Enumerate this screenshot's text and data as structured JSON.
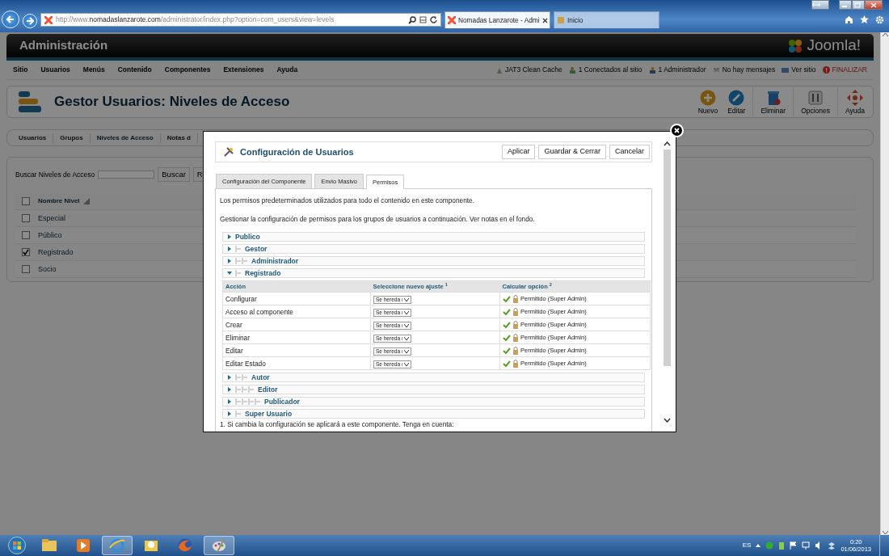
{
  "browser": {
    "url": "http://www.**nomadaslanzarote.com**/administrator/index.php?option=com_users&view=levels",
    "tabs": [
      {
        "title": "Nomadas Lanzarote - Admi",
        "selected": true,
        "closable": true
      },
      {
        "title": "Inicio",
        "selected": false,
        "closable": false
      }
    ]
  },
  "admin": {
    "title": "Administración",
    "logo": "Joomla!",
    "menu": [
      "Sitio",
      "Usuarios",
      "Menús",
      "Contenido",
      "Componentes",
      "Extensiones",
      "Ayuda"
    ],
    "status": [
      {
        "label": "JAT3 Clean Cache",
        "kind": "cache"
      },
      {
        "label": "1 Conectados al sitio",
        "kind": "users"
      },
      {
        "label": "1 Administrador",
        "kind": "admin"
      },
      {
        "label": "No hay mensajes",
        "kind": "mail"
      },
      {
        "label": "Ver sitio",
        "kind": "site"
      },
      {
        "label": "FINALIZAR",
        "kind": "logout"
      }
    ],
    "page_title": "Gestor Usuarios: Niveles de Acceso",
    "toolbar": [
      {
        "label": "Nuevo",
        "kind": "new"
      },
      {
        "label": "Editar",
        "kind": "edit"
      },
      {
        "label": "Eliminar",
        "kind": "delete"
      },
      {
        "label": "Opciones",
        "kind": "options"
      },
      {
        "label": "Ayuda",
        "kind": "help"
      }
    ],
    "subtabs": [
      {
        "label": "Usuarios",
        "selected": false
      },
      {
        "label": "Grupos",
        "selected": false
      },
      {
        "label": "Niveles de Acceso",
        "selected": true
      },
      {
        "label": "Notas d",
        "selected": false
      }
    ],
    "search": {
      "label": "Buscar Niveles de Acceso",
      "button": "Buscar",
      "reset": "R"
    },
    "levels": {
      "column": "Nombre Nivel",
      "all_checked": false,
      "rows": [
        {
          "name": "Especial",
          "checked": false
        },
        {
          "name": "Público",
          "checked": false
        },
        {
          "name": "Registrado",
          "checked": true
        },
        {
          "name": "Socio",
          "checked": false
        }
      ]
    }
  },
  "modal": {
    "title": "Configuración de Usuarios",
    "buttons": [
      "Aplicar",
      "Guardar & Cerrar",
      "Cancelar"
    ],
    "tabs": [
      {
        "label": "Configuración del Componente",
        "selected": false
      },
      {
        "label": "Envio Masivo",
        "selected": false
      },
      {
        "label": "Permisos",
        "selected": true
      }
    ],
    "intro": [
      "Los permisos predeterminados utilizados para todo el contenido en este componente.",
      "Gestionar la configuración de permisos para los grupos de usuarios a continuación. Ver notas en el fondo."
    ],
    "columns": [
      "Acción",
      "Seleccione nuevo ajuste $^{1}$",
      "Calcular opción $^{2}$"
    ],
    "groups": [
      {
        "label": "Publico",
        "expanded": false,
        "children": [
          {
            "label": "Gestor",
            "expanded": false,
            "children": [
              {
                "label": "Administrador",
                "expanded": false
              }
            ]
          },
          {
            "label": "Registrado",
            "expanded": true,
            "permissions": [
              {
                "action": "Configurar",
                "setting": "Se hereda",
                "result": "Permitido (Super Admin)"
              },
              {
                "action": "Acceso al componente",
                "setting": "Se hereda",
                "result": "Permitido (Super Admin)"
              },
              {
                "action": "Crear",
                "setting": "Se hereda",
                "result": "Permitido (Super Admin)"
              },
              {
                "action": "Eliminar",
                "setting": "Se hereda",
                "result": "Permitido (Super Admin)"
              },
              {
                "action": "Editar",
                "setting": "Se hereda",
                "result": "Permitido (Super Admin)"
              },
              {
                "action": "Editar Estado",
                "setting": "Se hereda",
                "result": "Permitido (Super Admin)"
              }
            ],
            "children": [
              {
                "label": "Autor",
                "expanded": false,
                "children": [
                  {
                    "label": "Editor",
                    "expanded": false,
                    "children": [
                      {
                        "label": "Publicador",
                        "expanded": false
                      }
                    ]
                  }
                ]
              }
            ]
          },
          {
            "label": "Super Usuario",
            "expanded": false
          }
        ]
      }
    ],
    "notes": [
      "1. Si cambia la configuración se aplicará a este componente. Tenga en cuenta:"
    ]
  },
  "taskbar": {
    "apps": [
      {
        "kind": "folder",
        "active": false
      },
      {
        "kind": "media",
        "active": false
      },
      {
        "kind": "browser",
        "active": true
      },
      {
        "kind": "mail",
        "active": false
      },
      {
        "kind": "fox",
        "active": false
      },
      {
        "kind": "paint",
        "active": true
      }
    ],
    "language": "ES",
    "time": "0:20",
    "date": "01/06/2013"
  }
}
